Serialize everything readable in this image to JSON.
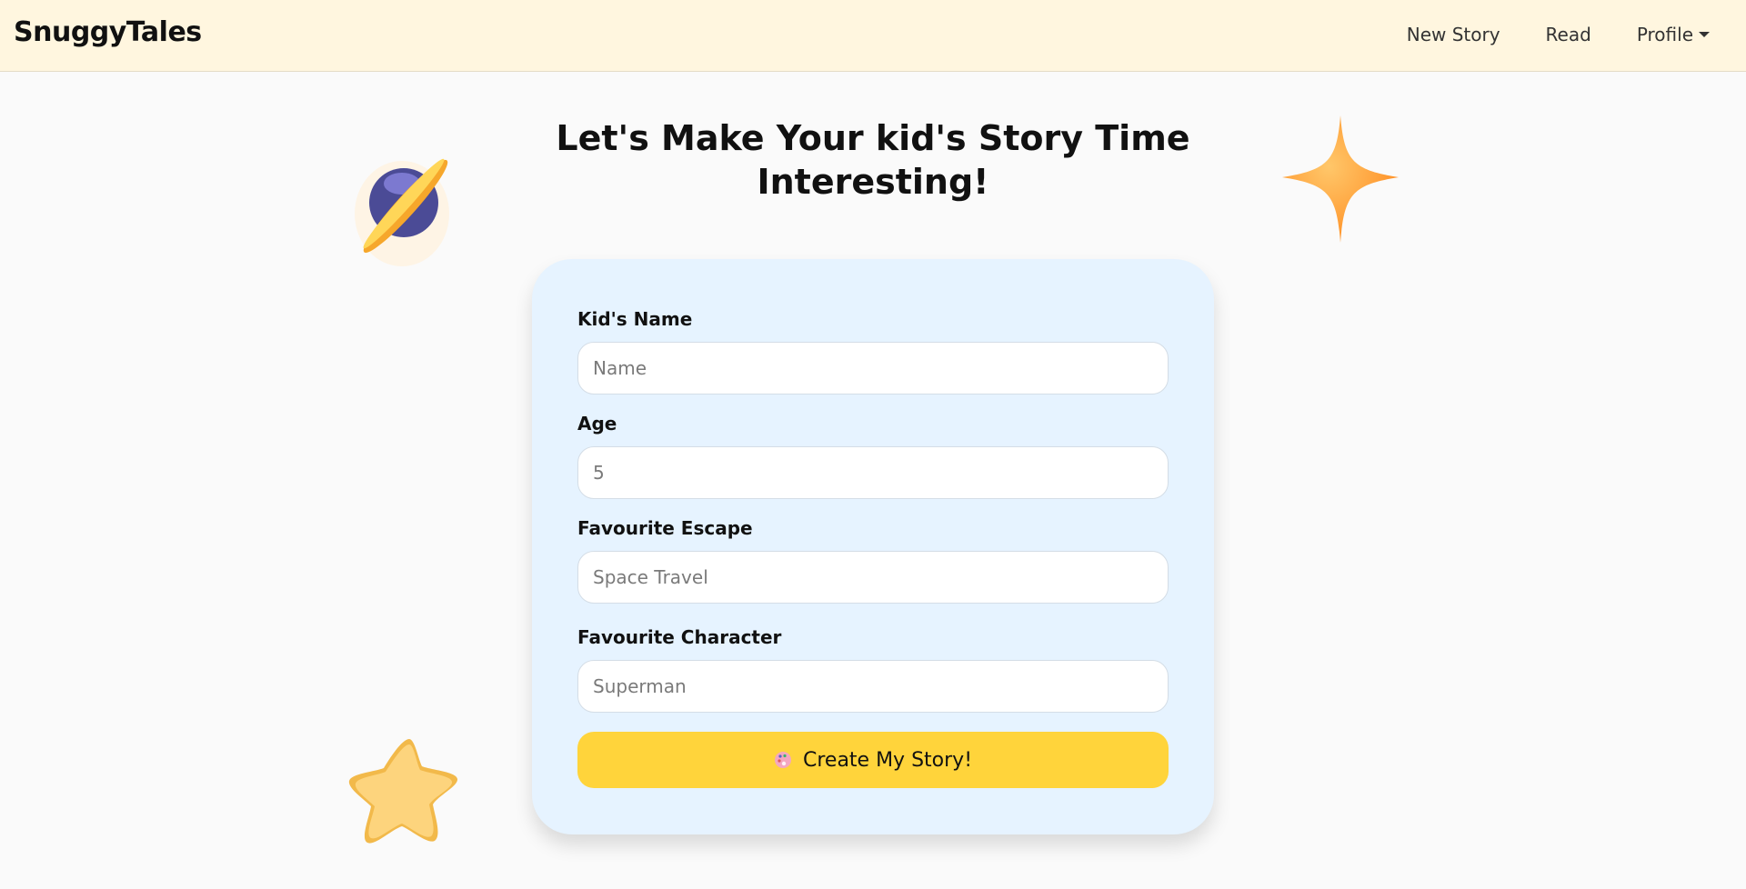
{
  "brand": "SnuggyTales",
  "nav": {
    "items": [
      {
        "label": "New Story"
      },
      {
        "label": "Read"
      },
      {
        "label": "Profile"
      }
    ]
  },
  "headline": {
    "line1": "Let's Make Your kid's Story Time",
    "line2": "Interesting!"
  },
  "form": {
    "name": {
      "label": "Kid's Name",
      "placeholder": "Name"
    },
    "age": {
      "label": "Age",
      "placeholder": "5"
    },
    "escape": {
      "label": "Favourite Escape",
      "placeholder": "Space Travel"
    },
    "character": {
      "label": "Favourite Character",
      "placeholder": "Superman"
    },
    "submit_label": "Create My Story!"
  },
  "icons": {
    "planet": "planet-icon",
    "sparkle": "sparkle-icon",
    "starfish": "star-icon",
    "button": "palette-icon"
  },
  "colors": {
    "navbar_bg": "#fff6df",
    "card_bg": "#e6f3ff",
    "button_bg": "#ffd43b",
    "accent_orange": "#ff9a2e"
  }
}
